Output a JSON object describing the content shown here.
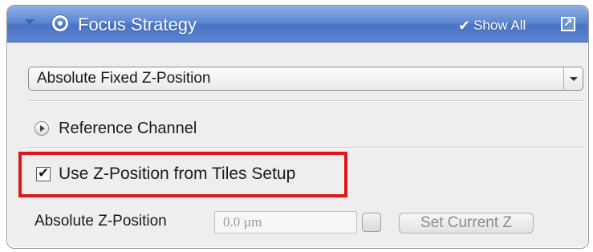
{
  "panel": {
    "title": "Focus Strategy",
    "show_all_label": "Show All",
    "icons": {
      "collapse": "chevron-down-icon",
      "focus": "focus-strategy-icon",
      "show_all_check": "check-icon",
      "undock": "undock-icon"
    }
  },
  "strategy_dropdown": {
    "selected": "Absolute Fixed Z-Position"
  },
  "reference_channel": {
    "label": "Reference Channel",
    "icon": "expand-arrow-icon"
  },
  "use_tiles_z": {
    "label": "Use Z-Position from Tiles Setup",
    "checked": true
  },
  "absolute_z": {
    "label": "Absolute Z-Position",
    "value": "0.0 µm",
    "set_current_label": "Set Current Z"
  },
  "colors": {
    "header_blue": "#5f88d3",
    "highlight_red": "#e0151b",
    "panel_bg": "#eeeeee"
  }
}
